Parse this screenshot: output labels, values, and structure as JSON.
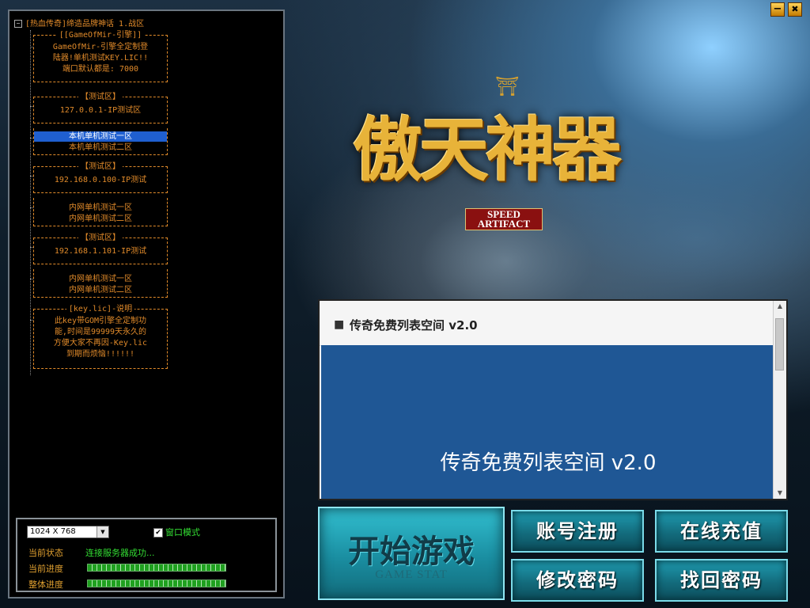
{
  "window": {
    "minimize_glyph": "−",
    "close_glyph": "✖"
  },
  "tree": {
    "root_label": "[热血传奇]缔造品牌神话 1.战区",
    "groups": [
      {
        "title": "[[GameOfMir-引擎]]",
        "lines": [
          "GameOfMir-引擎全定制登",
          "陆器!单机测试KEY.LIC!!",
          "端口默认都是: 7000"
        ]
      },
      {
        "title": "【测试区】",
        "lines": [
          "127.0.0.1-IP测试区"
        ]
      },
      {
        "title": "",
        "lines": [
          "本机单机测试一区",
          "本机单机测试二区"
        ],
        "selected_index": 0
      },
      {
        "title": "【测试区】",
        "lines": [
          "192.168.0.100-IP测试"
        ]
      },
      {
        "title": "",
        "lines": [
          "内网单机测试一区",
          "内网单机测试二区"
        ]
      },
      {
        "title": "【测试区】",
        "lines": [
          "192.168.1.101-IP测试"
        ]
      },
      {
        "title": "",
        "lines": [
          "内网单机测试一区",
          "内网单机测试二区"
        ]
      },
      {
        "title": "[key.lic]-说明",
        "lines": [
          "此key带GOM引擎全定制功",
          "能,时间是99999天永久的",
          "方便大家不再因-Key.lic",
          "到期而烦恼!!!!!!"
        ]
      }
    ]
  },
  "options": {
    "resolution_value": "1024 X 768",
    "window_mode_label": "窗口模式",
    "window_mode_checked": true,
    "status_label": "当前状态",
    "status_text": "连接服务器成功...",
    "current_progress_label": "当前进度",
    "current_progress": 1.0,
    "overall_progress_label": "整体进度",
    "overall_progress": 1.0
  },
  "logo": {
    "title": "傲天神器",
    "subtitle_line1": "SPEED",
    "subtitle_line2": "ARTIFACT"
  },
  "browser": {
    "header_title": "传奇免费列表空间 v2.0",
    "body_title": "传奇免费列表空间 v2.0"
  },
  "buttons": {
    "start_main": "开始游戏",
    "start_sub": "GAME STAT",
    "register": "账号注册",
    "recharge": "在线充值",
    "change_password": "修改密码",
    "recover_password": "找回密码"
  },
  "colors": {
    "tree_text": "#e08a2a",
    "selection": "#1f5fd0",
    "status_green": "#33dd33",
    "browser_blue": "#1f5795",
    "button_teal": "#1f9bb0"
  }
}
